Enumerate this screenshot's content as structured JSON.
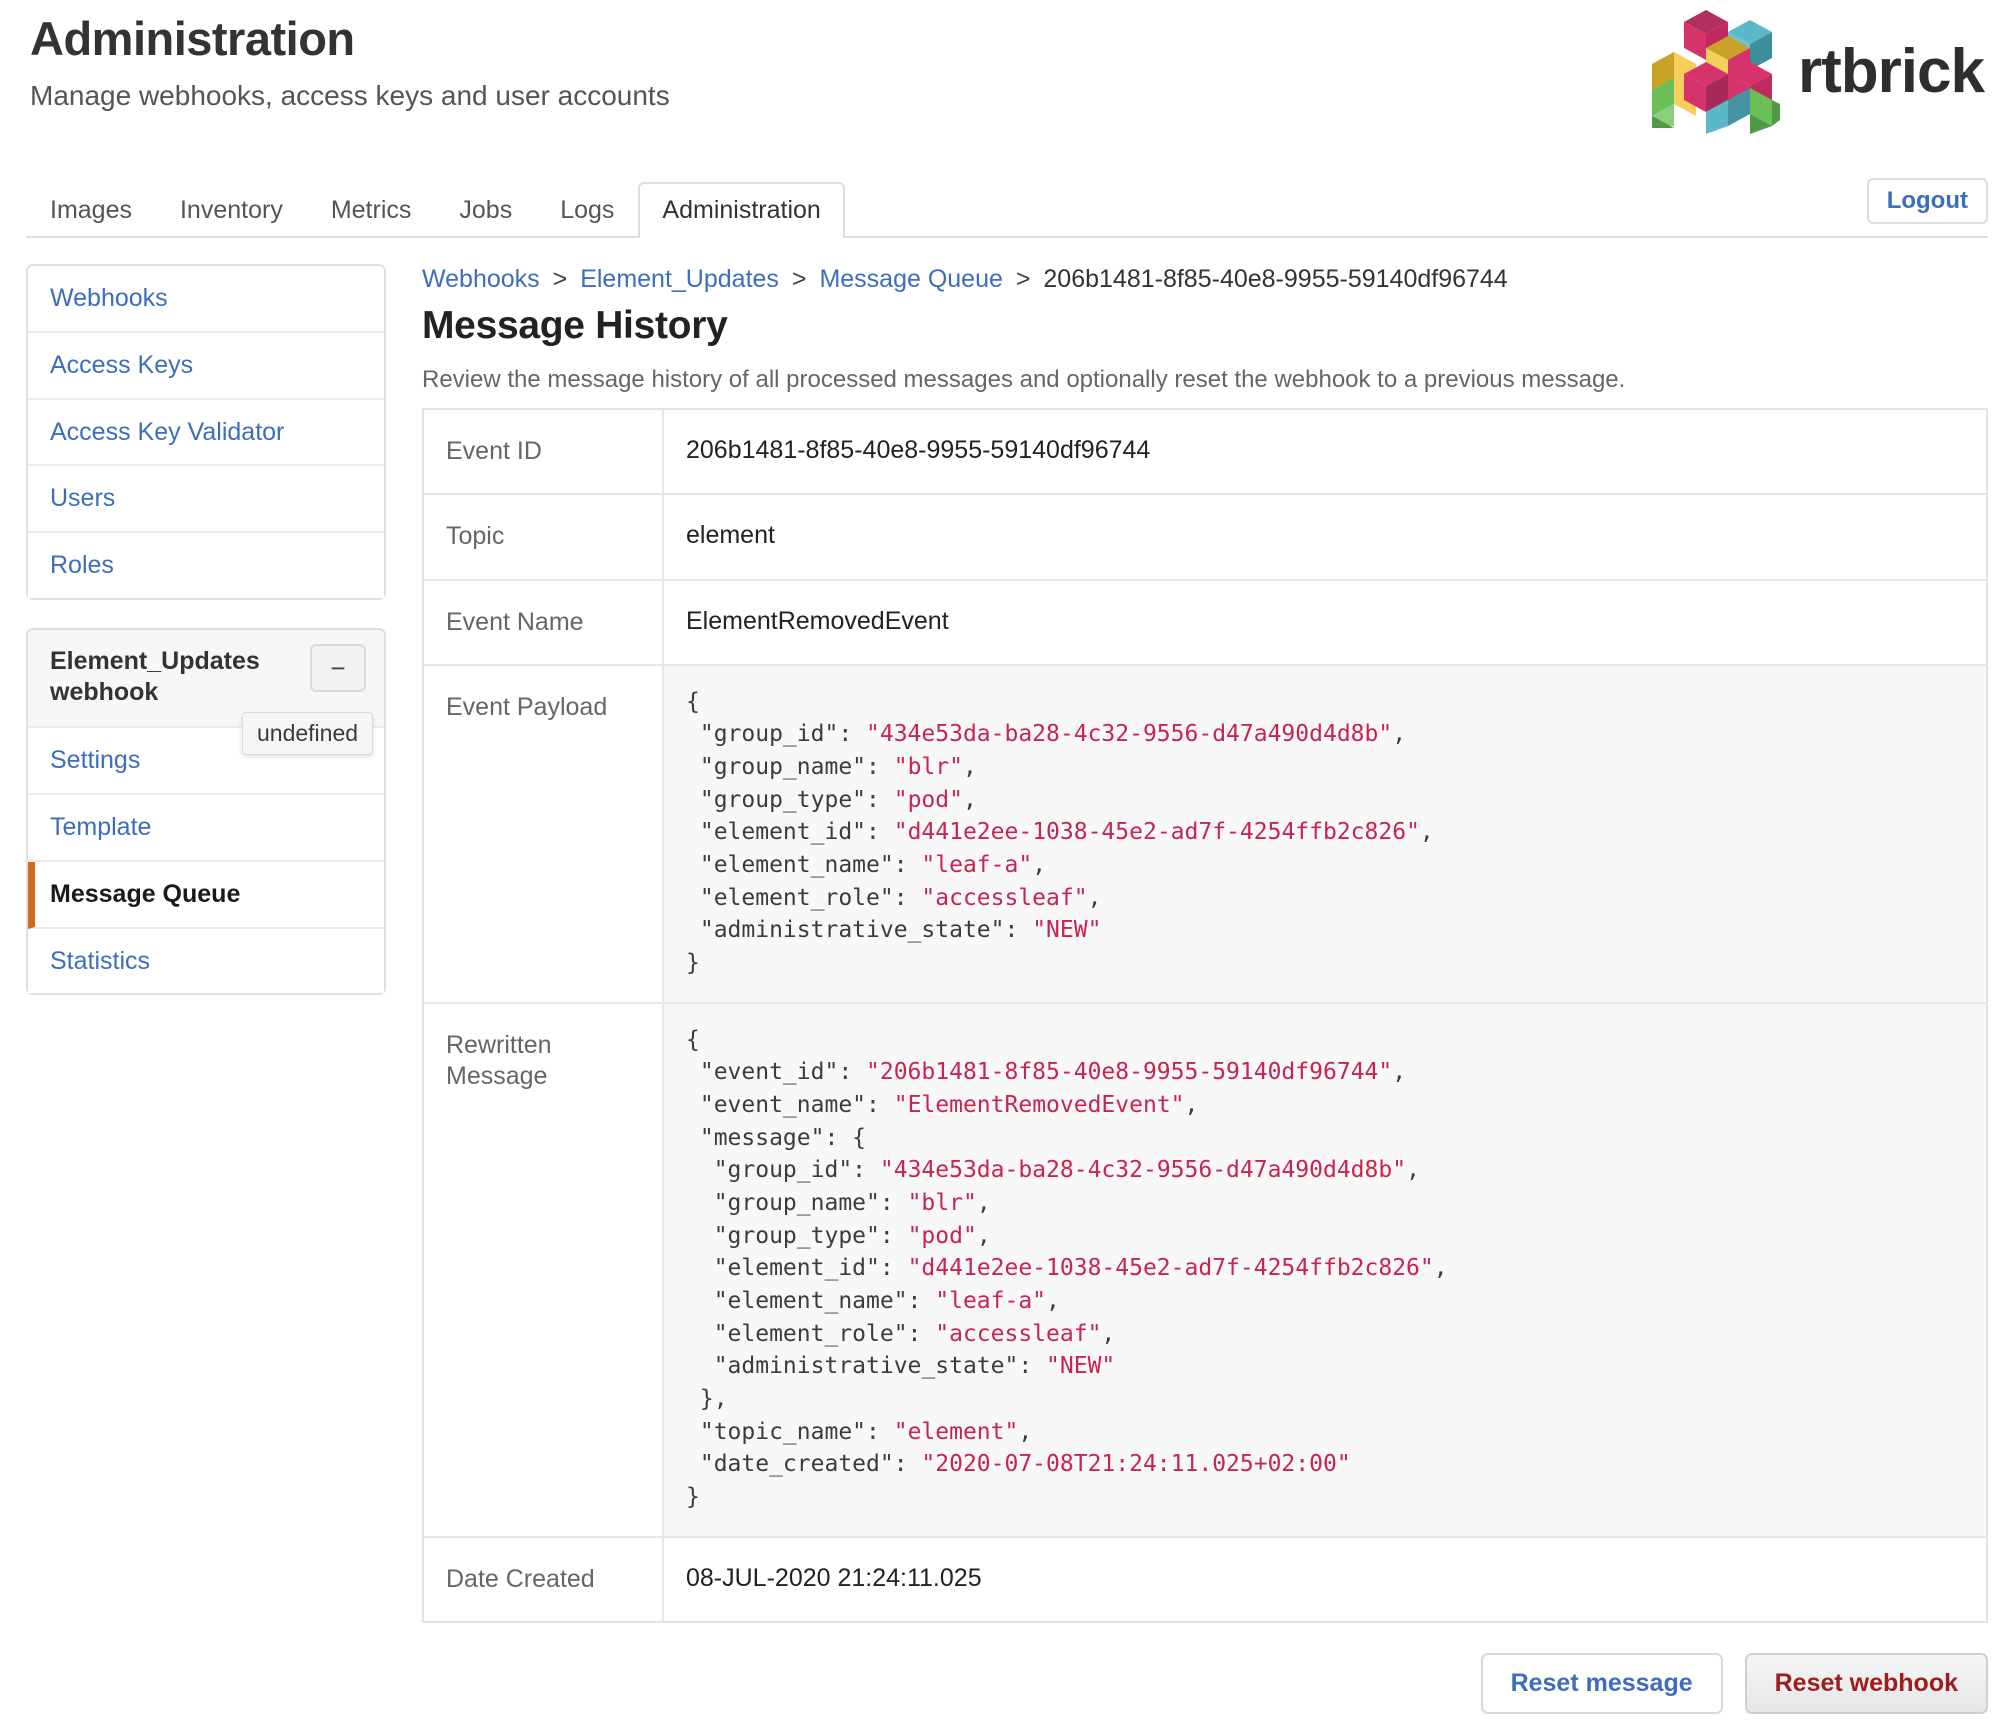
{
  "header": {
    "title": "Administration",
    "subtitle": "Manage webhooks, access keys and user accounts",
    "brand_name": "rtbrick",
    "brand_colors": {
      "magenta": "#d6336c",
      "crimson": "#b03060",
      "teal": "#5bb8c8",
      "teal_dark": "#3f8e9b",
      "gold": "#c9a227",
      "yellow": "#f5cf5b",
      "green": "#6bbf59",
      "green_dark": "#4e9a46"
    }
  },
  "tabs": [
    {
      "label": "Images",
      "active": false
    },
    {
      "label": "Inventory",
      "active": false
    },
    {
      "label": "Metrics",
      "active": false
    },
    {
      "label": "Jobs",
      "active": false
    },
    {
      "label": "Logs",
      "active": false
    },
    {
      "label": "Administration",
      "active": true
    }
  ],
  "logout": {
    "label": "Logout",
    "color": "#3d6ebd"
  },
  "sidebar": {
    "primary_items": [
      {
        "label": "Webhooks"
      },
      {
        "label": "Access Keys"
      },
      {
        "label": "Access Key Validator"
      },
      {
        "label": "Users"
      },
      {
        "label": "Roles"
      }
    ],
    "webhook_panel": {
      "title": "Element_Updates webhook",
      "collapse_label": "−",
      "tooltip": "undefined",
      "items": [
        {
          "label": "Settings",
          "current": false
        },
        {
          "label": "Template",
          "current": false
        },
        {
          "label": "Message Queue",
          "current": true
        },
        {
          "label": "Statistics",
          "current": false
        }
      ],
      "active_marker_color": "#d2691e"
    }
  },
  "main": {
    "breadcrumb": [
      {
        "label": "Webhooks",
        "link": true
      },
      {
        "label": "Element_Updates",
        "link": true
      },
      {
        "label": "Message Queue",
        "link": true
      },
      {
        "label": "206b1481-8f85-40e8-9955-59140df96744",
        "link": false
      }
    ],
    "breadcrumb_separator": ">",
    "title": "Message History",
    "description": "Review the message history of all processed messages and optionally reset the webhook to a previous message.",
    "rows": {
      "event_id_label": "Event ID",
      "event_id_value": "206b1481-8f85-40e8-9955-59140df96744",
      "topic_label": "Topic",
      "topic_value": "element",
      "event_name_label": "Event Name",
      "event_name_value": "ElementRemovedEvent",
      "event_payload_label": "Event Payload",
      "rewritten_message_label": "Rewritten Message",
      "date_created_label": "Date Created",
      "date_created_value": "08-JUL-2020 21:24:11.025"
    },
    "event_payload": {
      "group_id": "434e53da-ba28-4c32-9556-d47a490d4d8b",
      "group_name": "blr",
      "group_type": "pod",
      "element_id": "d441e2ee-1038-45e2-ad7f-4254ffb2c826",
      "element_name": "leaf-a",
      "element_role": "accessleaf",
      "administrative_state": "NEW"
    },
    "rewritten_message": {
      "event_id": "206b1481-8f85-40e8-9955-59140df96744",
      "event_name": "ElementRemovedEvent",
      "message": {
        "group_id": "434e53da-ba28-4c32-9556-d47a490d4d8b",
        "group_name": "blr",
        "group_type": "pod",
        "element_id": "d441e2ee-1038-45e2-ad7f-4254ffb2c826",
        "element_name": "leaf-a",
        "element_role": "accessleaf",
        "administrative_state": "NEW"
      },
      "topic_name": "element",
      "date_created": "2020-07-08T21:24:11.025+02:00"
    },
    "buttons": {
      "reset_message": "Reset message",
      "reset_webhook": "Reset webhook"
    }
  }
}
